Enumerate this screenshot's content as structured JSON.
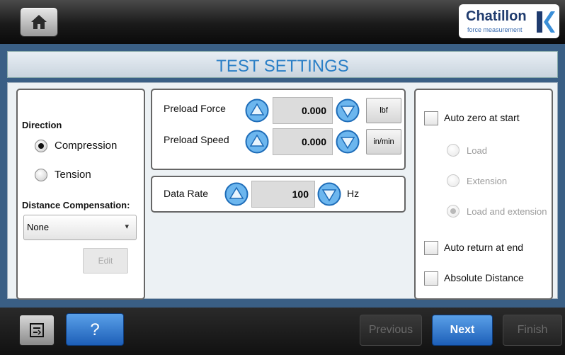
{
  "header": {
    "home_icon": "home-icon",
    "logo": {
      "name": "Chatillon",
      "tagline": "force measurement"
    }
  },
  "page": {
    "title": "TEST SETTINGS"
  },
  "direction": {
    "heading": "Direction",
    "options": [
      {
        "label": "Compression",
        "selected": true
      },
      {
        "label": "Tension",
        "selected": false
      }
    ],
    "distance_comp_heading": "Distance Compensation:",
    "distance_comp_value": "None",
    "edit_label": "Edit"
  },
  "preload": {
    "force": {
      "label": "Preload Force",
      "value": "0.000",
      "unit": "lbf"
    },
    "speed": {
      "label": "Preload Speed",
      "value": "0.000",
      "unit": "in/min"
    }
  },
  "datarate": {
    "label": "Data Rate",
    "value": "100",
    "unit": "Hz"
  },
  "options": {
    "auto_zero": {
      "label": "Auto zero at start",
      "checked": false
    },
    "zero_modes": [
      {
        "label": "Load",
        "selected": false
      },
      {
        "label": "Extension",
        "selected": false
      },
      {
        "label": "Load and extension",
        "selected": true
      }
    ],
    "auto_return": {
      "label": "Auto return at end",
      "checked": false
    },
    "absolute_distance": {
      "label": "Absolute Distance",
      "checked": false
    }
  },
  "footer": {
    "help_label": "?",
    "previous_label": "Previous",
    "next_label": "Next",
    "finish_label": "Finish"
  },
  "colors": {
    "accent": "#2a7fc6",
    "frame": "#3a5f85",
    "button_blue": "#1d5fb8"
  }
}
